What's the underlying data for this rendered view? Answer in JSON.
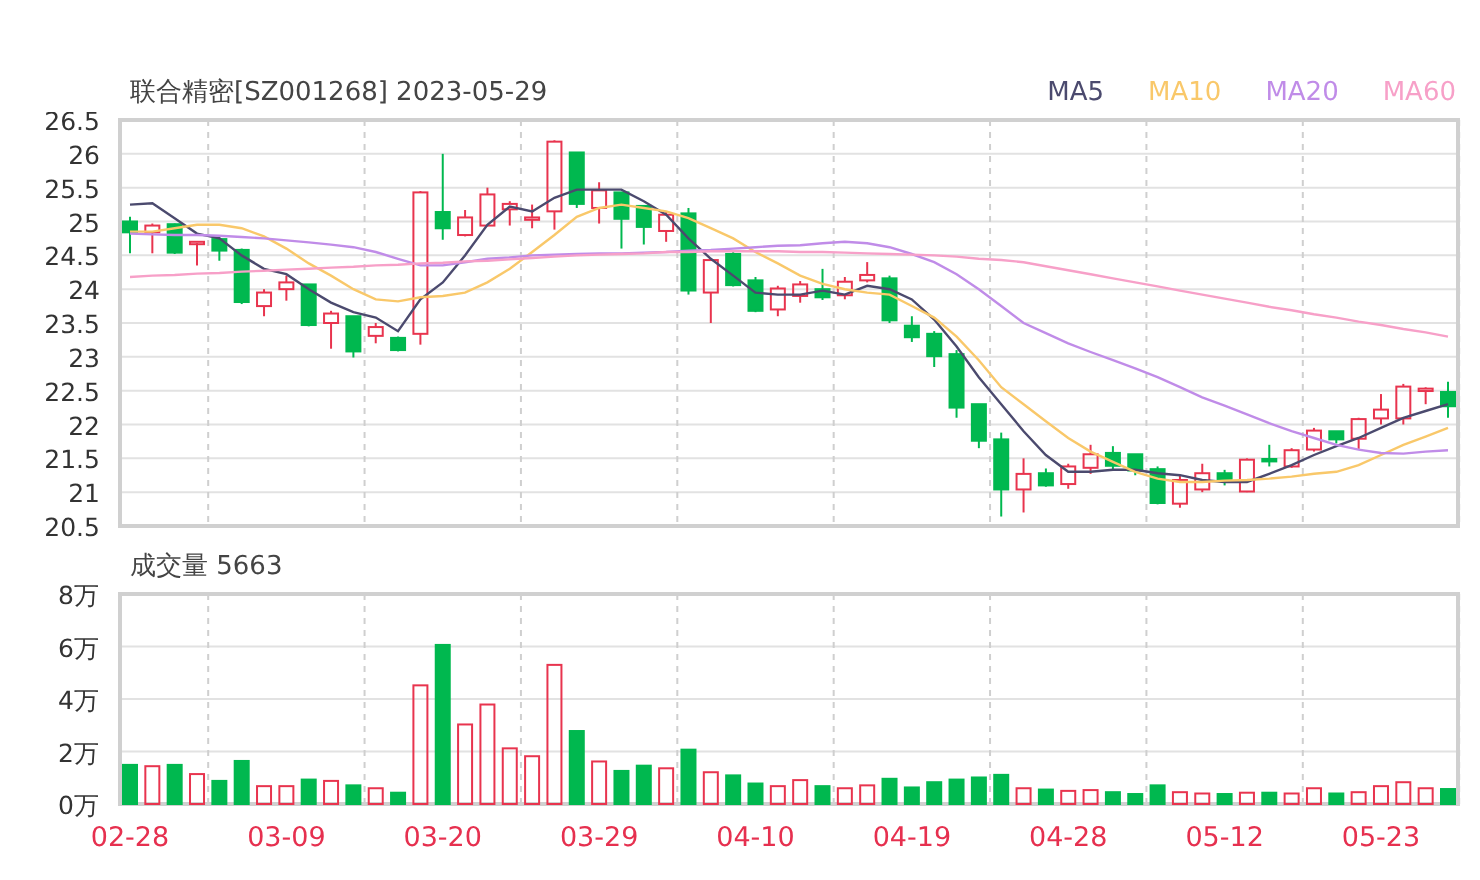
{
  "price_chart": {
    "chart_data": {
      "type": "candlestick",
      "title": "联合精密[SZ001268] 2023-05-29",
      "ylim": [
        20.5,
        26.5
      ],
      "grid": true,
      "yticks": [
        {
          "value": 26.5,
          "label": "26.5"
        },
        {
          "value": 26,
          "label": "26"
        },
        {
          "value": 25.5,
          "label": "25.5"
        },
        {
          "value": 25,
          "label": "25"
        },
        {
          "value": 24.5,
          "label": "24.5"
        },
        {
          "value": 24,
          "label": "24"
        },
        {
          "value": 23.5,
          "label": "23.5"
        },
        {
          "value": 23,
          "label": "23"
        },
        {
          "value": 22.5,
          "label": "22.5"
        },
        {
          "value": 22,
          "label": "22"
        },
        {
          "value": 21.5,
          "label": "21.5"
        },
        {
          "value": 21,
          "label": "21"
        },
        {
          "value": 20.5,
          "label": "20.5"
        }
      ],
      "ohlc": [
        [
          25.0,
          25.07,
          24.53,
          24.84
        ],
        [
          24.84,
          24.97,
          24.53,
          24.94
        ],
        [
          24.96,
          24.97,
          24.52,
          24.54
        ],
        [
          24.68,
          24.7,
          24.35,
          24.7
        ],
        [
          24.74,
          24.78,
          24.42,
          24.57
        ],
        [
          24.58,
          24.6,
          23.78,
          23.81
        ],
        [
          23.75,
          24.0,
          23.6,
          23.95
        ],
        [
          24.0,
          24.2,
          23.83,
          24.1
        ],
        [
          24.07,
          24.07,
          23.45,
          23.47
        ],
        [
          23.5,
          23.68,
          23.12,
          23.64
        ],
        [
          23.6,
          23.6,
          22.99,
          23.08
        ],
        [
          23.31,
          23.5,
          23.2,
          23.44
        ],
        [
          23.28,
          23.3,
          23.08,
          23.1
        ],
        [
          23.34,
          25.45,
          23.18,
          25.43
        ],
        [
          25.14,
          26.0,
          24.73,
          24.9
        ],
        [
          24.8,
          25.17,
          24.78,
          25.06
        ],
        [
          24.94,
          25.5,
          24.93,
          25.4
        ],
        [
          25.18,
          25.3,
          24.94,
          25.26
        ],
        [
          25.04,
          25.25,
          24.9,
          25.06
        ],
        [
          25.15,
          26.2,
          24.88,
          26.18
        ],
        [
          26.02,
          26.02,
          25.2,
          25.26
        ],
        [
          25.2,
          25.58,
          24.97,
          25.46
        ],
        [
          25.43,
          25.43,
          24.6,
          25.04
        ],
        [
          25.23,
          25.23,
          24.66,
          24.92
        ],
        [
          24.86,
          25.14,
          24.7,
          25.1
        ],
        [
          25.12,
          25.2,
          23.92,
          23.98
        ],
        [
          23.95,
          24.45,
          23.5,
          24.43
        ],
        [
          24.52,
          24.55,
          24.04,
          24.06
        ],
        [
          24.13,
          24.18,
          23.66,
          23.68
        ],
        [
          23.7,
          24.05,
          23.6,
          24.01
        ],
        [
          23.9,
          24.12,
          23.8,
          24.07
        ],
        [
          24.0,
          24.3,
          23.84,
          23.88
        ],
        [
          23.91,
          24.18,
          23.85,
          24.11
        ],
        [
          24.13,
          24.4,
          24.1,
          24.21
        ],
        [
          24.16,
          24.2,
          23.5,
          23.54
        ],
        [
          23.46,
          23.6,
          23.22,
          23.29
        ],
        [
          23.34,
          23.38,
          22.85,
          23.01
        ],
        [
          23.04,
          23.1,
          22.1,
          22.25
        ],
        [
          22.3,
          22.3,
          21.65,
          21.76
        ],
        [
          21.78,
          21.88,
          20.64,
          21.04
        ],
        [
          21.04,
          21.5,
          20.7,
          21.27
        ],
        [
          21.28,
          21.35,
          21.08,
          21.1
        ],
        [
          21.12,
          21.42,
          21.05,
          21.38
        ],
        [
          21.36,
          21.7,
          21.27,
          21.56
        ],
        [
          21.58,
          21.68,
          21.32,
          21.39
        ],
        [
          21.56,
          21.56,
          21.25,
          21.32
        ],
        [
          21.34,
          21.38,
          20.82,
          20.84
        ],
        [
          20.83,
          21.25,
          20.77,
          21.18
        ],
        [
          21.04,
          21.42,
          21.0,
          21.28
        ],
        [
          21.28,
          21.33,
          21.1,
          21.18
        ],
        [
          21.01,
          21.5,
          21.0,
          21.48
        ],
        [
          21.49,
          21.7,
          21.38,
          21.47
        ],
        [
          21.38,
          21.65,
          21.36,
          21.62
        ],
        [
          21.63,
          21.95,
          21.6,
          21.91
        ],
        [
          21.9,
          21.9,
          21.72,
          21.78
        ],
        [
          21.79,
          22.1,
          21.64,
          22.08
        ],
        [
          22.09,
          22.45,
          22.0,
          22.22
        ],
        [
          22.09,
          22.6,
          22.0,
          22.56
        ],
        [
          22.5,
          22.55,
          22.3,
          22.53
        ],
        [
          22.48,
          22.63,
          22.1,
          22.27
        ]
      ],
      "series": [
        {
          "name": "MA5",
          "type": "line",
          "color": "#4b4a6e",
          "values": [
            25.25,
            25.27,
            25.05,
            24.82,
            24.75,
            24.5,
            24.3,
            24.22,
            24.0,
            23.8,
            23.66,
            23.58,
            23.38,
            23.85,
            24.1,
            24.5,
            24.95,
            25.22,
            25.15,
            25.35,
            25.47,
            25.47,
            25.47,
            25.3,
            25.1,
            24.75,
            24.45,
            24.2,
            23.95,
            23.92,
            23.92,
            23.98,
            23.92,
            24.05,
            24.0,
            23.85,
            23.55,
            23.15,
            22.7,
            22.3,
            21.9,
            21.55,
            21.3,
            21.3,
            21.33,
            21.33,
            21.28,
            21.25,
            21.18,
            21.15,
            21.15,
            21.27,
            21.4,
            21.55,
            21.68,
            21.8,
            21.95,
            22.1,
            22.2,
            22.3
          ]
        },
        {
          "name": "MA10",
          "type": "line",
          "color": "#f9c86a",
          "values": [
            24.85,
            24.85,
            24.9,
            24.95,
            24.95,
            24.9,
            24.78,
            24.6,
            24.38,
            24.2,
            24.0,
            23.85,
            23.82,
            23.88,
            23.9,
            23.95,
            24.1,
            24.3,
            24.55,
            24.8,
            25.07,
            25.2,
            25.25,
            25.2,
            25.15,
            25.05,
            24.9,
            24.75,
            24.55,
            24.38,
            24.2,
            24.08,
            24.0,
            23.95,
            23.92,
            23.75,
            23.58,
            23.3,
            22.95,
            22.55,
            22.3,
            22.05,
            21.8,
            21.6,
            21.45,
            21.3,
            21.2,
            21.15,
            21.15,
            21.17,
            21.18,
            21.2,
            21.23,
            21.27,
            21.3,
            21.4,
            21.55,
            21.7,
            21.82,
            21.95
          ]
        },
        {
          "name": "MA20",
          "type": "line",
          "color": "#c08ce8",
          "values": [
            24.82,
            24.81,
            24.8,
            24.8,
            24.79,
            24.77,
            24.75,
            24.72,
            24.69,
            24.66,
            24.62,
            24.55,
            24.45,
            24.35,
            24.35,
            24.4,
            24.45,
            24.47,
            24.5,
            24.51,
            24.52,
            24.53,
            24.53,
            24.54,
            24.55,
            24.57,
            24.58,
            24.6,
            24.62,
            24.64,
            24.65,
            24.68,
            24.7,
            24.68,
            24.62,
            24.52,
            24.4,
            24.22,
            24.0,
            23.75,
            23.5,
            23.35,
            23.2,
            23.07,
            22.95,
            22.83,
            22.7,
            22.55,
            22.4,
            22.28,
            22.15,
            22.02,
            21.9,
            21.8,
            21.7,
            21.63,
            21.58,
            21.57,
            21.6,
            21.62
          ]
        },
        {
          "name": "MA60",
          "type": "line",
          "color": "#f7a0c8",
          "values": [
            24.18,
            24.2,
            24.21,
            24.23,
            24.24,
            24.26,
            24.27,
            24.29,
            24.3,
            24.32,
            24.33,
            24.35,
            24.36,
            24.38,
            24.39,
            24.41,
            24.42,
            24.44,
            24.46,
            24.48,
            24.5,
            24.51,
            24.52,
            24.53,
            24.55,
            24.55,
            24.56,
            24.56,
            24.56,
            24.56,
            24.55,
            24.55,
            24.54,
            24.53,
            24.52,
            24.51,
            24.5,
            24.48,
            24.45,
            24.43,
            24.4,
            24.34,
            24.28,
            24.22,
            24.16,
            24.1,
            24.04,
            23.98,
            23.92,
            23.86,
            23.8,
            23.74,
            23.69,
            23.63,
            23.58,
            23.52,
            23.47,
            23.41,
            23.36,
            23.3
          ]
        }
      ]
    }
  },
  "volume_chart": {
    "chart_data": {
      "type": "bar",
      "title": "成交量 5663",
      "ylim": [
        0,
        8
      ],
      "grid": true,
      "categories": [
        "02-28",
        null,
        null,
        null,
        null,
        null,
        null,
        "03-09",
        null,
        null,
        null,
        null,
        null,
        null,
        "03-20",
        null,
        null,
        null,
        null,
        null,
        null,
        "03-29",
        null,
        null,
        null,
        null,
        null,
        null,
        "04-10",
        null,
        null,
        null,
        null,
        null,
        null,
        "04-19",
        null,
        null,
        null,
        null,
        null,
        null,
        "04-28",
        null,
        null,
        null,
        null,
        null,
        null,
        "05-12",
        null,
        null,
        null,
        null,
        null,
        null,
        "05-23",
        null,
        null,
        null
      ],
      "yticks": [
        {
          "value": 8,
          "label": "8万"
        },
        {
          "value": 6,
          "label": "6万"
        },
        {
          "value": 4,
          "label": "4万"
        },
        {
          "value": 2,
          "label": "2万"
        },
        {
          "value": 0,
          "label": "0万"
        }
      ],
      "values": [
        1.49,
        1.44,
        1.49,
        1.14,
        0.88,
        1.64,
        0.68,
        0.68,
        0.93,
        0.88,
        0.71,
        0.6,
        0.43,
        4.52,
        6.06,
        3.03,
        3.79,
        2.12,
        1.82,
        5.3,
        2.78,
        1.62,
        1.26,
        1.46,
        1.36,
        2.07,
        1.21,
        1.09,
        0.78,
        0.68,
        0.91,
        0.68,
        0.6,
        0.71,
        0.96,
        0.63,
        0.83,
        0.93,
        1.01,
        1.11,
        0.6,
        0.55,
        0.5,
        0.53,
        0.45,
        0.38,
        0.71,
        0.45,
        0.4,
        0.38,
        0.43,
        0.43,
        0.4,
        0.6,
        0.4,
        0.45,
        0.68,
        0.83,
        0.6,
        0.57
      ]
    }
  }
}
